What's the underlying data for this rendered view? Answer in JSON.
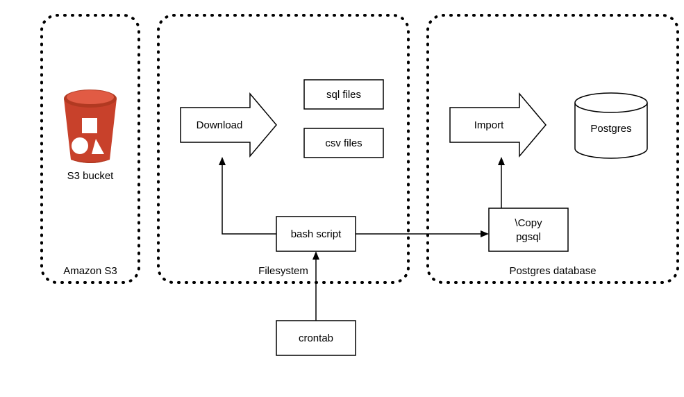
{
  "containers": {
    "amazon_s3": {
      "label": "Amazon S3"
    },
    "filesystem": {
      "label": "Filesystem"
    },
    "postgres_db": {
      "label": "Postgres database"
    }
  },
  "nodes": {
    "s3_bucket": {
      "label": "S3 bucket"
    },
    "download_arrow": {
      "label": "Download"
    },
    "sql_files": {
      "label": "sql files"
    },
    "csv_files": {
      "label": "csv files"
    },
    "bash_script": {
      "label": "bash script"
    },
    "crontab": {
      "label": "crontab"
    },
    "import_arrow": {
      "label": "Import"
    },
    "copy_pgsql": {
      "label1": "\\Copy",
      "label2": "pgsql"
    },
    "postgres_cylinder": {
      "label": "Postgres"
    }
  },
  "chart_data": {
    "type": "diagram",
    "title": "",
    "containers": [
      {
        "id": "amazon_s3",
        "label": "Amazon S3",
        "children": [
          "s3_bucket"
        ]
      },
      {
        "id": "filesystem",
        "label": "Filesystem",
        "children": [
          "download_arrow",
          "sql_files",
          "csv_files",
          "bash_script"
        ]
      },
      {
        "id": "postgres_db",
        "label": "Postgres database",
        "children": [
          "import_arrow",
          "copy_pgsql",
          "postgres_cylinder"
        ]
      }
    ],
    "nodes": [
      {
        "id": "s3_bucket",
        "label": "S3 bucket",
        "shape": "s3-bucket-icon"
      },
      {
        "id": "download_arrow",
        "label": "Download",
        "shape": "block-arrow-right"
      },
      {
        "id": "sql_files",
        "label": "sql files",
        "shape": "rect"
      },
      {
        "id": "csv_files",
        "label": "csv files",
        "shape": "rect"
      },
      {
        "id": "bash_script",
        "label": "bash script",
        "shape": "rect"
      },
      {
        "id": "crontab",
        "label": "crontab",
        "shape": "rect"
      },
      {
        "id": "import_arrow",
        "label": "Import",
        "shape": "block-arrow-right"
      },
      {
        "id": "copy_pgsql",
        "label": "\\Copy pgsql",
        "shape": "rect"
      },
      {
        "id": "postgres_cylinder",
        "label": "Postgres",
        "shape": "cylinder"
      }
    ],
    "edges": [
      {
        "from": "crontab",
        "to": "bash_script"
      },
      {
        "from": "bash_script",
        "to": "download_arrow"
      },
      {
        "from": "bash_script",
        "to": "copy_pgsql"
      },
      {
        "from": "copy_pgsql",
        "to": "import_arrow"
      }
    ]
  }
}
